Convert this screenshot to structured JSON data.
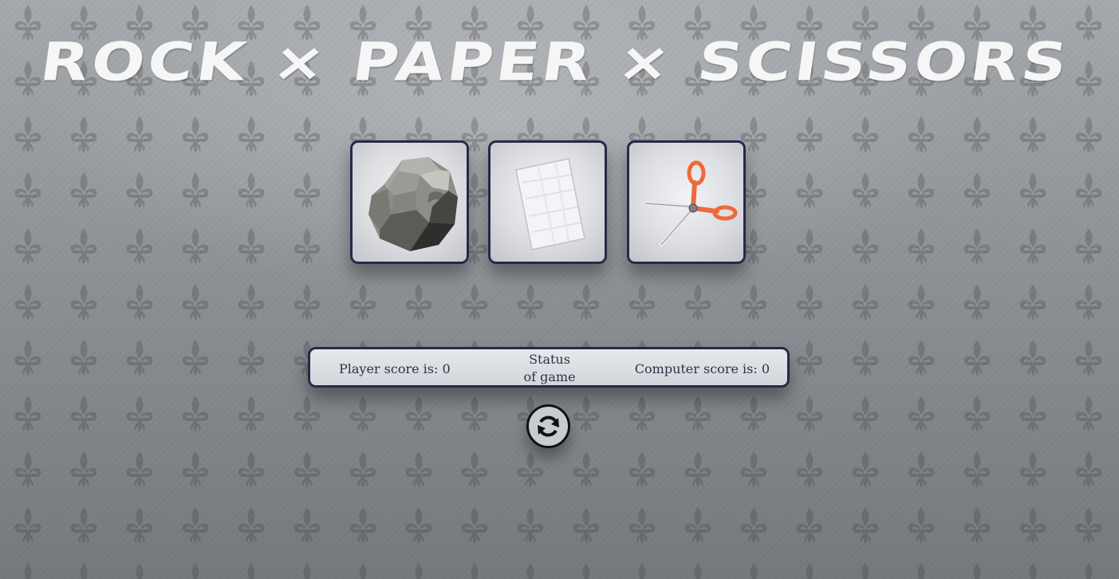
{
  "title": {
    "part1": "ROCK",
    "sep1": "×",
    "part2": "PAPER",
    "sep2": "×",
    "part3": "SCISSORS"
  },
  "choices": [
    {
      "id": "rock",
      "icon": "rock-icon"
    },
    {
      "id": "paper",
      "icon": "paper-icon"
    },
    {
      "id": "scissors",
      "icon": "scissors-icon"
    }
  ],
  "scoreboard": {
    "player_label": "Player score is: 0",
    "status_line1": "Status",
    "status_line2": "of game",
    "computer_label": "Computer score is: 0"
  },
  "reset": {
    "icon": "refresh-icon"
  },
  "colors": {
    "border": "#27294a",
    "scissors_handle": "#ee6a3a",
    "title": "#f6f6f6"
  }
}
